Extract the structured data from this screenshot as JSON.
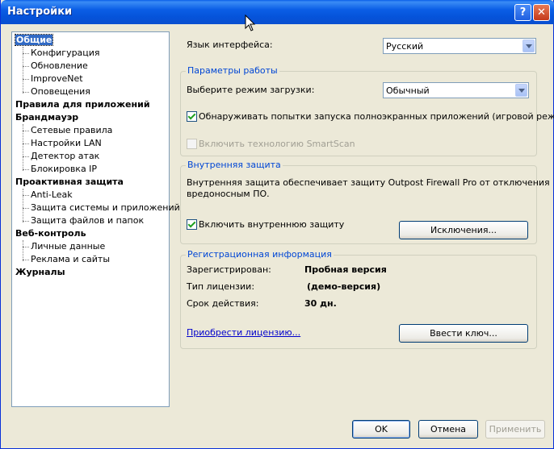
{
  "window": {
    "title": "Настройки",
    "help_label": "?",
    "close_label": "✕"
  },
  "tree": {
    "items": [
      {
        "label": "Общие",
        "level": 0,
        "selected": true
      },
      {
        "label": "Конфигурация",
        "level": 1
      },
      {
        "label": "Обновление",
        "level": 1
      },
      {
        "label": "ImproveNet",
        "level": 1
      },
      {
        "label": "Оповещения",
        "level": 1
      },
      {
        "label": "Правила для приложений",
        "level": 0
      },
      {
        "label": "Брандмауэр",
        "level": 0
      },
      {
        "label": "Сетевые правила",
        "level": 1
      },
      {
        "label": "Настройки LAN",
        "level": 1
      },
      {
        "label": "Детектор атак",
        "level": 1
      },
      {
        "label": "Блокировка IP",
        "level": 1
      },
      {
        "label": "Проактивная защита",
        "level": 0
      },
      {
        "label": "Anti-Leak",
        "level": 1
      },
      {
        "label": "Защита системы и приложений",
        "level": 1
      },
      {
        "label": "Защита файлов и папок",
        "level": 1
      },
      {
        "label": "Веб-контроль",
        "level": 0
      },
      {
        "label": "Личные данные",
        "level": 1
      },
      {
        "label": "Реклама и сайты",
        "level": 1
      },
      {
        "label": "Журналы",
        "level": 0
      }
    ]
  },
  "language": {
    "label": "Язык интерфейса:",
    "value": "Русский"
  },
  "work_params": {
    "title": "Параметры работы",
    "mode_label": "Выберите режим загрузки:",
    "mode_value": "Обычный",
    "fullscreen_label": "Обнаруживать попытки запуска полноэкранных приложений (игровой режим)",
    "fullscreen_checked": true,
    "smartscan_label": "Включить технологию SmartScan",
    "smartscan_checked": false
  },
  "internal": {
    "title": "Внутренняя защита",
    "description_line1": "Внутренняя защита обеспечивает защиту Outpost Firewall Pro от отключения",
    "description_line2": "вредоносным ПО.",
    "enable_label": "Включить внутреннюю защиту",
    "enable_checked": true,
    "exceptions_button": "Исключения..."
  },
  "registration": {
    "title": "Регистрационная информация",
    "registered_label": "Зарегистрирован:",
    "registered_value": "Пробная версия",
    "license_type_label": "Тип лицензии:",
    "license_type_value": "(демо-версия)",
    "validity_label": "Срок действия:",
    "validity_value": "30 дн.",
    "buy_link": "Приобрести лицензию...",
    "enter_key_button": "Ввести ключ..."
  },
  "footer": {
    "ok": "OK",
    "cancel": "Отмена",
    "apply": "Применить"
  }
}
